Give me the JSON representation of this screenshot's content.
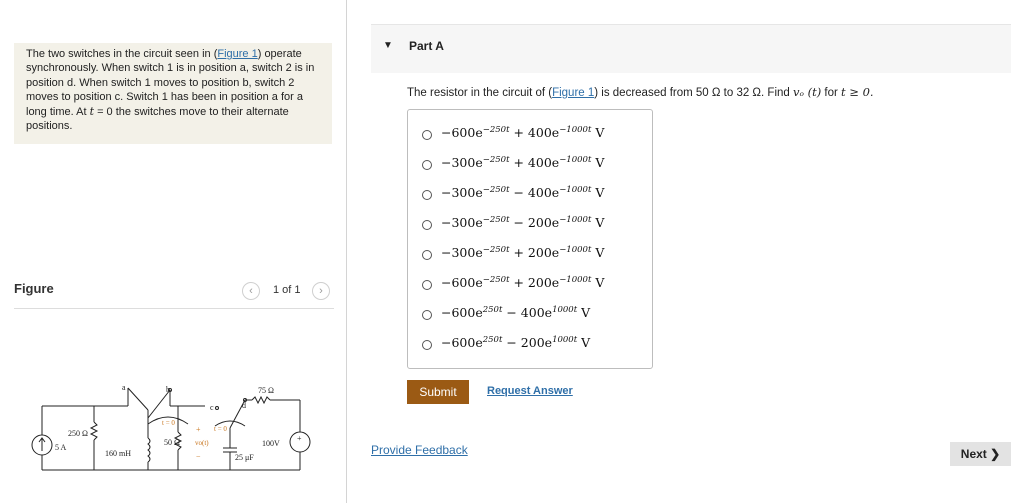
{
  "problem": {
    "text_before_link": "The two switches in the circuit seen in (",
    "figure_link": "Figure 1",
    "text_after_link": ") operate synchronously. When switch 1 is in position a, switch 2 is in position d. When switch 1 moves to position b, switch 2 moves to position c. Switch 1 has been in position a for a long time. At ",
    "t_var": "t",
    "text_end": " = 0 the switches move to their alternate positions."
  },
  "figure": {
    "title": "Figure",
    "counter": "1 of 1",
    "prev_icon": "‹",
    "next_icon": "›",
    "labels": {
      "source_current": "5 A",
      "r250": "250 Ω",
      "l160": "160 mH",
      "t0_left": "t = 0",
      "r50": "50 Ω",
      "plus": "+",
      "minus": "−",
      "vo": "vo(t)",
      "t0_right": "t = 0",
      "cap": "25 μF",
      "r75": "75 Ω",
      "v100": "100V",
      "a": "a",
      "b": "b",
      "c": "c",
      "d": "d"
    }
  },
  "part": {
    "caret_icon": "▼",
    "title": "Part A"
  },
  "question": {
    "before_link": "The resistor in the circuit of (",
    "link": "Figure 1",
    "after_link": ") is decreased from 50 Ω to 32 Ω. Find ",
    "vo": "vₒ (t)",
    "for": " for ",
    "cond": "t ≥ 0."
  },
  "options": [
    {
      "a": "−600e",
      "e1": "−250t",
      "op": " + 400e",
      "e2": "−1000t",
      "unit": " V"
    },
    {
      "a": "−300e",
      "e1": "−250t",
      "op": " + 400e",
      "e2": "−1000t",
      "unit": " V"
    },
    {
      "a": "−300e",
      "e1": "−250t",
      "op": " − 400e",
      "e2": "−1000t",
      "unit": " V"
    },
    {
      "a": "−300e",
      "e1": "−250t",
      "op": " − 200e",
      "e2": "−1000t",
      "unit": " V"
    },
    {
      "a": "−300e",
      "e1": "−250t",
      "op": " + 200e",
      "e2": "−1000t",
      "unit": " V"
    },
    {
      "a": "−600e",
      "e1": "−250t",
      "op": " + 200e",
      "e2": "−1000t",
      "unit": " V"
    },
    {
      "a": "−600e",
      "e1": "250t",
      "op": " − 400e",
      "e2": "1000t",
      "unit": " V"
    },
    {
      "a": "−600e",
      "e1": "250t",
      "op": " − 200e",
      "e2": "1000t",
      "unit": " V"
    }
  ],
  "actions": {
    "submit": "Submit",
    "request_answer": "Request Answer",
    "provide_feedback": "Provide Feedback",
    "next": "Next ❯"
  },
  "colors": {
    "link": "#2f6fa8",
    "submit_bg": "#9b5a14",
    "problem_bg": "#f3f1e8"
  }
}
